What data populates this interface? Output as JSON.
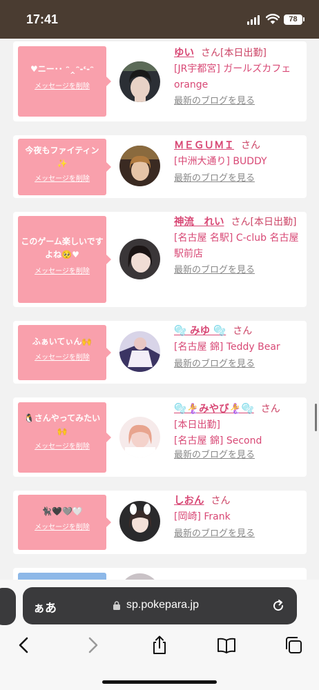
{
  "status_bar": {
    "time": "17:41",
    "battery": "78"
  },
  "delete_label": "メッセージを削除",
  "blog_label": "最新のブログを見る",
  "san": "さん",
  "cards": [
    {
      "message": "♥ニー･･ ᵔ‸ᵔ-ᵋ-ᵔ",
      "name": "ゆい",
      "san_inline": "さん[本日出勤]",
      "shop": "[JR宇都宮] ガールズカフェ orange"
    },
    {
      "message": "今夜もファイティン✨",
      "name": "ＭＥＧＵＭＩ",
      "shop": "[中洲大通り] BUDDY"
    },
    {
      "message": "このゲーム楽しいですよね🥺♥",
      "name": "神流　れい",
      "san_inline": "さん[本日出勤]",
      "shop": "[名古屋 名駅] C-club 名古屋駅前店"
    },
    {
      "message": "ふぁいてぃん🙌",
      "name": "🫧 みゆ 🫧",
      "shop": "[名古屋 錦] Teddy Bear"
    },
    {
      "message": "🐧さんやってみたい🙌",
      "name": "🫧🧜‍♀️みやび🧜‍♀️🫧",
      "status": "[本日出勤]",
      "shop": "[名古屋 錦] Second"
    },
    {
      "message": "🐈‍⬛🖤🩶🤍",
      "name": "しおん",
      "shop": "[岡崎] Frank"
    }
  ],
  "browser": {
    "aa": "ぁあ",
    "domain": "sp.pokepara.jp"
  }
}
